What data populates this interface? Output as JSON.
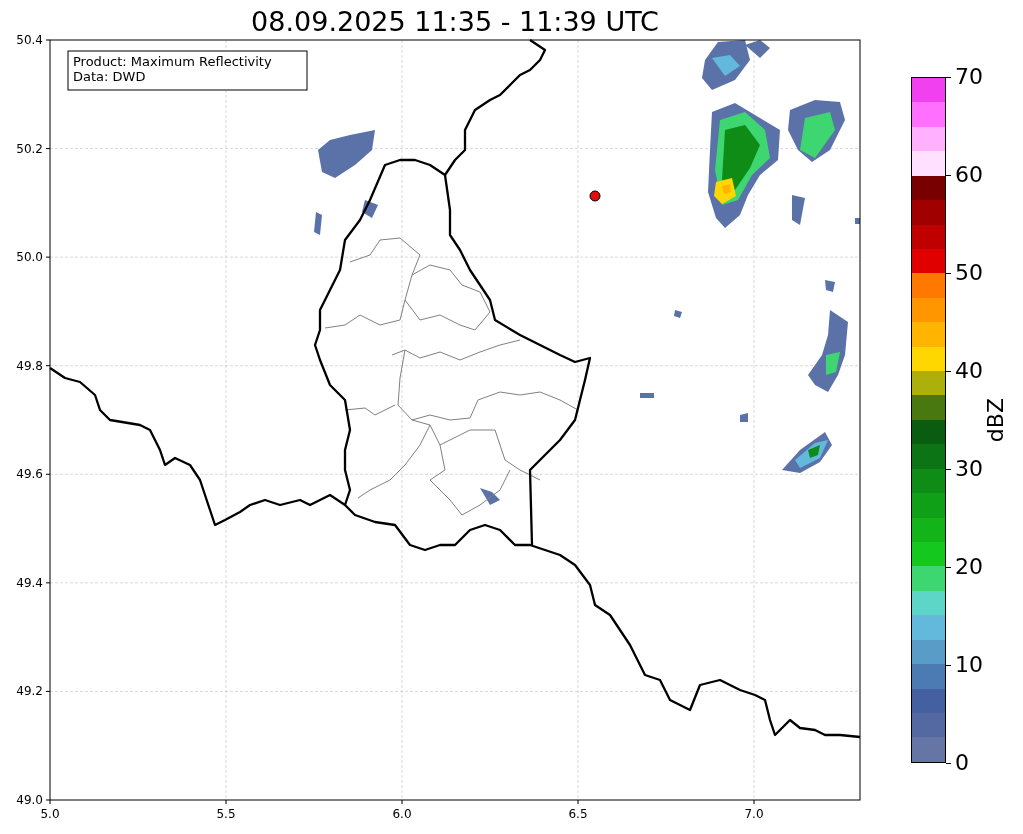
{
  "title": "08.09.2025 11:35 - 11:39 UTC",
  "legend": [
    "Product: Maximum Reflectivity",
    "Data: DWD"
  ],
  "map": {
    "x_ticks": [
      "5.0",
      "5.5",
      "6.0",
      "6.5",
      "7.0"
    ],
    "y_ticks": [
      "50.4",
      "50.2",
      "50.0",
      "49.8",
      "49.6",
      "49.4",
      "49.2",
      "49.0"
    ]
  },
  "colorbar": {
    "label": "dBZ",
    "ticks": [
      "70",
      "60",
      "50",
      "40",
      "30",
      "20",
      "10",
      "0"
    ],
    "segments": [
      {
        "color": "#6475a6"
      },
      {
        "color": "#5468a2"
      },
      {
        "color": "#4560a0"
      },
      {
        "color": "#4b7bb2"
      },
      {
        "color": "#5a9cc8"
      },
      {
        "color": "#63b9dc"
      },
      {
        "color": "#5ed6c7"
      },
      {
        "color": "#3dd670"
      },
      {
        "color": "#14c81e"
      },
      {
        "color": "#12b41a"
      },
      {
        "color": "#10a018"
      },
      {
        "color": "#0e8c16"
      },
      {
        "color": "#0c7414"
      },
      {
        "color": "#0a5c10"
      },
      {
        "color": "#4a7810"
      },
      {
        "color": "#adb00a"
      },
      {
        "color": "#ffd700"
      },
      {
        "color": "#ffb400"
      },
      {
        "color": "#ff9600"
      },
      {
        "color": "#ff7800"
      },
      {
        "color": "#e00000"
      },
      {
        "color": "#c00000"
      },
      {
        "color": "#a00000"
      },
      {
        "color": "#780000"
      },
      {
        "color": "#ffe0ff"
      },
      {
        "color": "#ffb0ff"
      },
      {
        "color": "#ff70ff"
      },
      {
        "color": "#f040f0"
      }
    ]
  }
}
